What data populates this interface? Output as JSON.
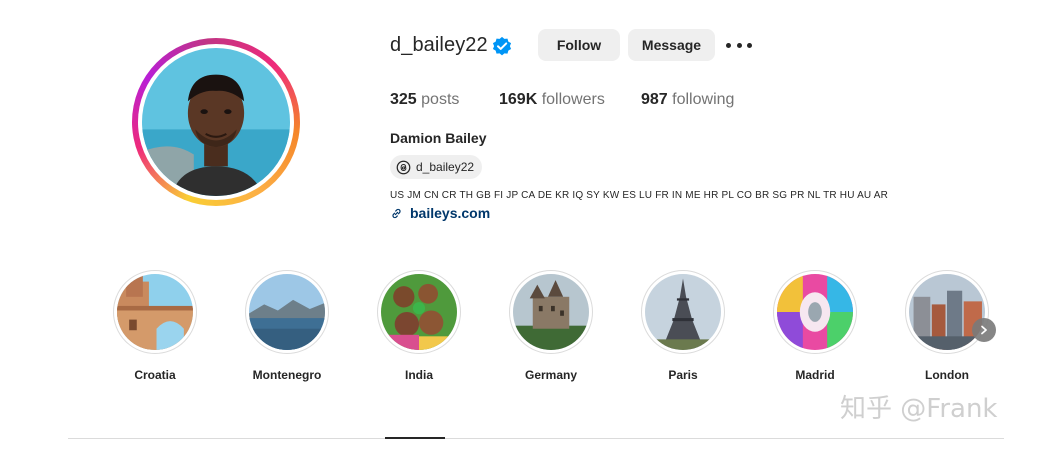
{
  "profile": {
    "username": "d_bailey22",
    "verified": true,
    "follow_label": "Follow",
    "message_label": "Message",
    "more_icon": "more-horizontal-icon",
    "full_name": "Damion Bailey",
    "threads_handle": "d_bailey22",
    "bio_countries": "US JM CN CR TH GB FI JP CA DE KR IQ SY KW ES LU FR IN ME HR PL CO BR SG PR NL TR HU AU AR",
    "bio_link": "baileys.com"
  },
  "stats": {
    "posts_count": "325",
    "posts_label": "posts",
    "followers_count": "169K",
    "followers_label": "followers",
    "following_count": "987",
    "following_label": "following"
  },
  "highlights": [
    {
      "label": "Croatia"
    },
    {
      "label": "Montenegro"
    },
    {
      "label": "India"
    },
    {
      "label": "Germany"
    },
    {
      "label": "Paris"
    },
    {
      "label": "Madrid"
    },
    {
      "label": "London"
    }
  ],
  "watermark": "知乎 @Frank",
  "colors": {
    "verified_blue": "#0095f6",
    "link_blue": "#00376b",
    "button_bg": "#efefef",
    "ring_gradient": [
      "#f9ce34",
      "#ee2a7b",
      "#b81fd6"
    ]
  }
}
